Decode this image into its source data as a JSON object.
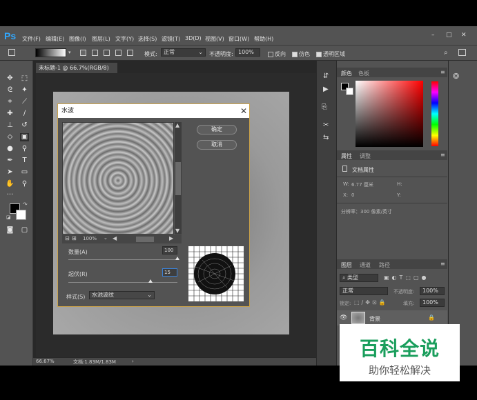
{
  "app": {
    "logo": "Ps"
  },
  "menu": [
    "文件(F)",
    "编辑(E)",
    "图像(I)",
    "图层(L)",
    "文字(Y)",
    "选择(S)",
    "滤镜(T)",
    "3D(D)",
    "视图(V)",
    "窗口(W)",
    "帮助(H)"
  ],
  "options": {
    "mode_label": "模式:",
    "mode_value": "正常",
    "opacity_label": "不透明度:",
    "opacity_value": "100%",
    "reverse_label": "反向",
    "dither_label": "仿色",
    "transparency_label": "透明区域"
  },
  "document": {
    "tab_title": "未标题-1 @ 66.7%(RGB/8) *",
    "zoom": "66.67%",
    "doc_size": "文档:1.83M/1.83M"
  },
  "panels": {
    "color_tab": "颜色",
    "swatches_tab": "色板",
    "properties_tab": "属性",
    "adjustments_tab": "调整",
    "doc_props": "文档属性",
    "w_label": "W:",
    "w_value": "6.77 厘米",
    "h_label": "H:",
    "x_label": "X:",
    "x_value": "0",
    "y_label": "Y:",
    "resolution": "分辨率：300 像素/英寸",
    "layers_tab": "图层",
    "channels_tab": "通道",
    "paths_tab": "路径",
    "kind_label": "类型",
    "blend_mode": "正常",
    "opacity_label": "不透明度:",
    "opacity_value": "100%",
    "lock_label": "锁定:",
    "fill_label": "填充:",
    "fill_value": "100%",
    "layer_name": "背景"
  },
  "dialog": {
    "title": "水波",
    "ok_label": "确定",
    "cancel_label": "取消",
    "zoom_value": "100%",
    "amount_label": "数量(A)",
    "amount_value": "100",
    "amount_fraction": 1.0,
    "ridges_label": "起伏(R)",
    "ridges_value": "15",
    "ridges_fraction": 0.75,
    "style_label": "样式(S)",
    "style_value": "水池波纹"
  },
  "watermark": {
    "title": "百科全说",
    "subtitle": "助你轻松解决"
  }
}
